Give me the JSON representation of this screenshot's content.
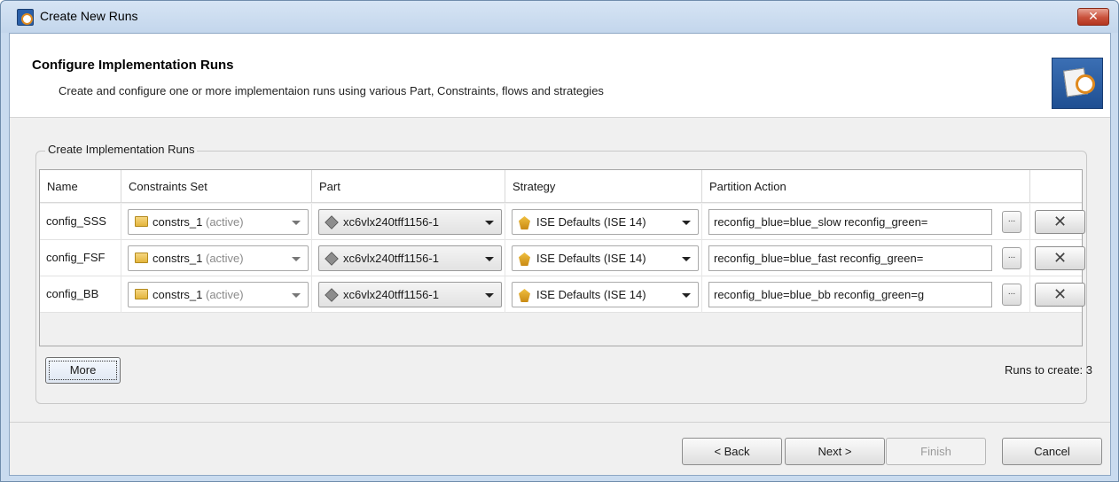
{
  "window": {
    "title": "Create New Runs",
    "close_label": "✕"
  },
  "header": {
    "title": "Configure Implementation Runs",
    "subtitle": "Create and configure one or more implementaion runs using various Part, Constraints, flows and strategies",
    "icon": "wizard-settings-icon"
  },
  "group": {
    "title": "Create Implementation Runs"
  },
  "table": {
    "columns": [
      "Name",
      "Constraints Set",
      "Part",
      "Strategy",
      "Partition Action"
    ],
    "rows": [
      {
        "name": "config_SSS",
        "constraints": "constrs_1",
        "constraints_tag": "(active)",
        "part": "xc6vlx240tff1156-1",
        "strategy": "ISE Defaults (ISE 14)",
        "partition_action": "reconfig_blue=blue_slow reconfig_green="
      },
      {
        "name": "config_FSF",
        "constraints": "constrs_1",
        "constraints_tag": "(active)",
        "part": "xc6vlx240tff1156-1",
        "strategy": "ISE Defaults (ISE 14)",
        "partition_action": "reconfig_blue=blue_fast reconfig_green="
      },
      {
        "name": "config_BB",
        "constraints": "constrs_1",
        "constraints_tag": "(active)",
        "part": "xc6vlx240tff1156-1",
        "strategy": "ISE Defaults (ISE 14)",
        "partition_action": "reconfig_blue=blue_bb reconfig_green=g"
      }
    ],
    "browse_label": "...",
    "remove_label": "✕"
  },
  "more_button": "More",
  "runs_to_create": "Runs to create: 3",
  "footer": {
    "back": "< Back",
    "next": "Next >",
    "finish": "Finish",
    "cancel": "Cancel"
  }
}
